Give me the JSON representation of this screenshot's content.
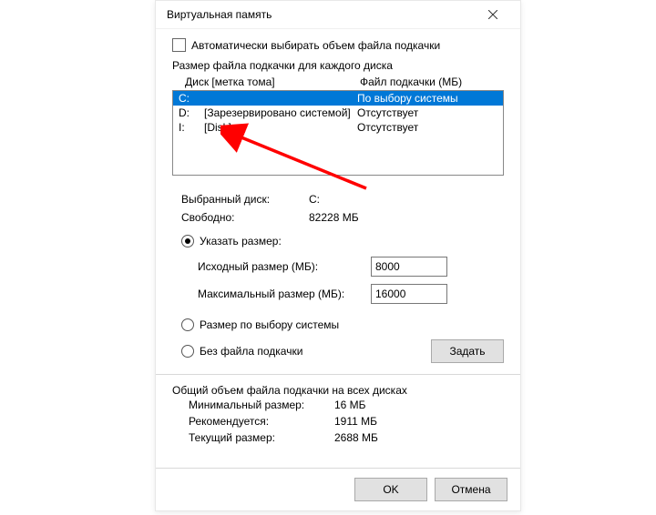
{
  "window": {
    "title": "Виртуальная память"
  },
  "auto_manage": {
    "label": "Автоматически выбирать объем файла подкачки"
  },
  "list": {
    "caption": "Размер файла подкачки для каждого диска",
    "col_disk": "Диск [метка тома]",
    "col_pf": "Файл подкачки (МБ)",
    "rows": [
      {
        "drive": "C:",
        "label": "",
        "pf": "По выбору системы"
      },
      {
        "drive": "D:",
        "label": "[Зарезервировано системой]",
        "pf": "Отсутствует"
      },
      {
        "drive": "I:",
        "label": "[Disk]",
        "pf": "Отсутствует"
      }
    ]
  },
  "selected": {
    "drive_label": "Выбранный диск:",
    "drive_value": "C:",
    "free_label": "Свободно:",
    "free_value": "82228 МБ"
  },
  "radios": {
    "custom": "Указать размер:",
    "system": "Размер по выбору системы",
    "none": "Без файла подкачки"
  },
  "inputs": {
    "initial_label": "Исходный размер (МБ):",
    "initial_value": "8000",
    "max_label": "Максимальный размер (МБ):",
    "max_value": "16000"
  },
  "buttons": {
    "set": "Задать",
    "ok": "OK",
    "cancel": "Отмена"
  },
  "totals": {
    "caption": "Общий объем файла подкачки на всех дисках",
    "min_label": "Минимальный размер:",
    "min_value": "16 МБ",
    "rec_label": "Рекомендуется:",
    "rec_value": "1911 МБ",
    "cur_label": "Текущий размер:",
    "cur_value": "2688 МБ"
  }
}
